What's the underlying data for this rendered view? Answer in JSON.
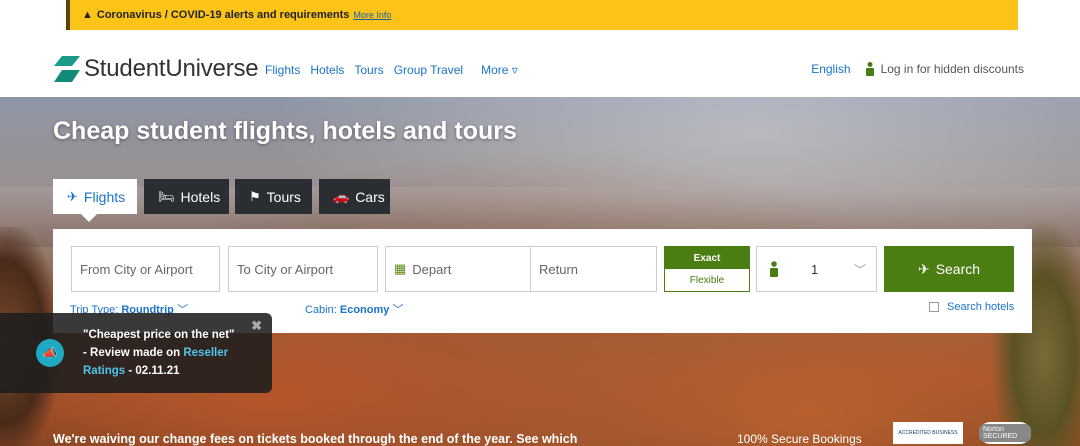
{
  "alert": {
    "text": "Coronavirus / COVID-19 alerts and requirements",
    "link": "More Info"
  },
  "header": {
    "logo": "StudentUniverse",
    "nav": [
      "Flights",
      "Hotels",
      "Tours",
      "Group Travel"
    ],
    "more": "More ▿",
    "language": "English",
    "login": "Log in for hidden discounts"
  },
  "hero": {
    "title": "Cheap student flights, hotels and tours",
    "tabs": [
      "Flights",
      "Hotels",
      "Tours",
      "Cars"
    ]
  },
  "search": {
    "from_placeholder": "From City or Airport",
    "to_placeholder": "To City or Airport",
    "depart": "Depart",
    "return": "Return",
    "exact": "Exact",
    "flexible": "Flexible",
    "passengers": "1",
    "button": "Search",
    "trip_type_label": "Trip Type:",
    "trip_type_value": "Roundtrip",
    "cabin_label": "Cabin:",
    "cabin_value": "Economy",
    "search_hotels": "Search hotels"
  },
  "toast": {
    "quote": "\"Cheapest price on the net\"",
    "review_prefix": "- Review made on",
    "link": "Reseller Ratings",
    "date": "- 02.11.21"
  },
  "footer": {
    "waive": "We're waiving our change fees on tickets booked through the end of the year. See which",
    "secure": "100% Secure Bookings",
    "bbb": "ACCREDITED BUSINESS",
    "norton": "Norton SECURED"
  },
  "colors": {
    "alert_bg": "#fcc419",
    "brand_green": "#4a7d12",
    "link_blue": "#1a73c9",
    "logo_teal": "#1a9b8a"
  }
}
